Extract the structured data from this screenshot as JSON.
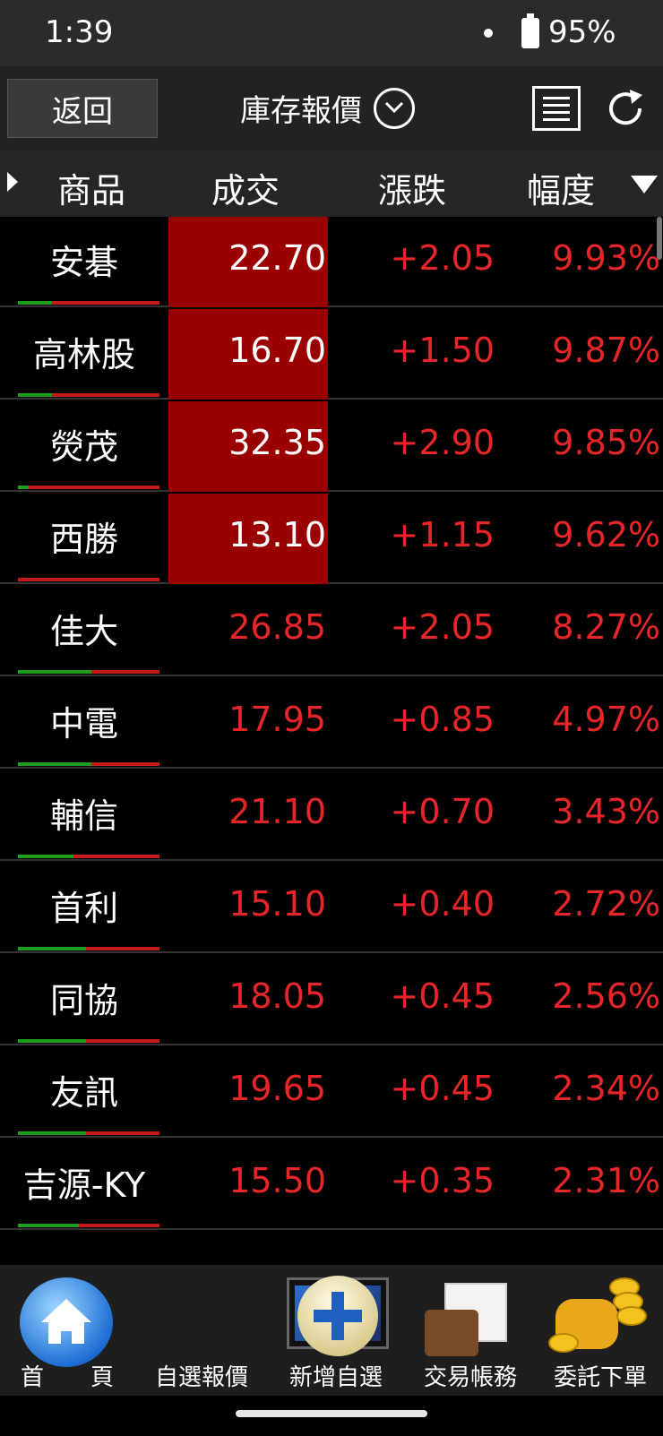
{
  "status_bar": {
    "time": "1:39",
    "battery": "95%"
  },
  "toolbar": {
    "back_label": "返回",
    "title": "庫存報價"
  },
  "table": {
    "headers": [
      "商品",
      "成交",
      "漲跌",
      "幅度"
    ],
    "rows": [
      {
        "name": "安碁",
        "price": "22.70",
        "change": "+2.05",
        "pct": "9.93%",
        "limit_up": true
      },
      {
        "name": "高林股",
        "price": "16.70",
        "change": "+1.50",
        "pct": "9.87%",
        "limit_up": true
      },
      {
        "name": "熒茂",
        "price": "32.35",
        "change": "+2.90",
        "pct": "9.85%",
        "limit_up": true
      },
      {
        "name": "西勝",
        "price": "13.10",
        "change": "+1.15",
        "pct": "9.62%",
        "limit_up": true
      },
      {
        "name": "佳大",
        "price": "26.85",
        "change": "+2.05",
        "pct": "8.27%",
        "limit_up": false
      },
      {
        "name": "中電",
        "price": "17.95",
        "change": "+0.85",
        "pct": "4.97%",
        "limit_up": false
      },
      {
        "name": "輔信",
        "price": "21.10",
        "change": "+0.70",
        "pct": "3.43%",
        "limit_up": false
      },
      {
        "name": "首利",
        "price": "15.10",
        "change": "+0.40",
        "pct": "2.72%",
        "limit_up": false
      },
      {
        "name": "同協",
        "price": "18.05",
        "change": "+0.45",
        "pct": "2.56%",
        "limit_up": false
      },
      {
        "name": "友訊",
        "price": "19.65",
        "change": "+0.45",
        "pct": "2.34%",
        "limit_up": false
      },
      {
        "name": "吉源-KY",
        "price": "15.50",
        "change": "+0.35",
        "pct": "2.31%",
        "limit_up": false
      }
    ]
  },
  "bottom_nav": [
    {
      "label": "首　　頁",
      "icon": "home-icon"
    },
    {
      "label": "自選報價",
      "icon": "tablet-chart-icon"
    },
    {
      "label": "新增自選",
      "icon": "plus-icon"
    },
    {
      "label": "交易帳務",
      "icon": "wallet-icon"
    },
    {
      "label": "委託下單",
      "icon": "coin-icon"
    }
  ],
  "colors": {
    "up": "#e8262a",
    "limit_up_bg": "#9b0000",
    "bid": "#1e9e1e",
    "ask": "#c41a1a"
  }
}
